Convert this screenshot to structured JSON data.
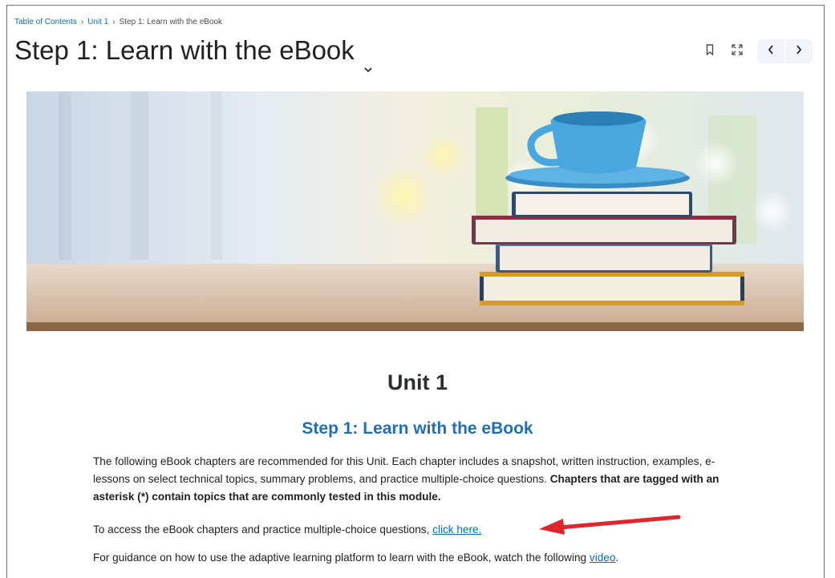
{
  "breadcrumb": {
    "items": [
      "Table of Contents",
      "Unit 1",
      "Step 1: Learn with the eBook"
    ],
    "separator": "›"
  },
  "page": {
    "title": "Step 1: Learn with the eBook"
  },
  "toolbar": {
    "icons": [
      "bookmark-icon",
      "fullscreen-icon",
      "chevron-left-icon",
      "chevron-right-icon"
    ]
  },
  "content": {
    "unit_heading": "Unit 1",
    "step_heading": "Step 1: Learn with the eBook",
    "paragraph1_text": "The following eBook chapters are recommended for this Unit. Each chapter includes a snapshot, written instruction, examples, e-lessons on select technical topics, summary problems, and practice multiple-choice questions. ",
    "paragraph1_bold": "Chapters that are tagged with an asterisk (*) contain topics that are commonly tested in this module.",
    "paragraph2_text": "To access the eBook chapters and practice multiple-choice questions, ",
    "paragraph2_link": "click here.",
    "paragraph3_text": "For guidance on how to use the adaptive learning platform to learn with the eBook, watch the following ",
    "paragraph3_link": "video",
    "paragraph3_end": "."
  },
  "colors": {
    "link": "#006fbf",
    "step_heading": "#1f6fb5",
    "arrow": "#e0262b"
  }
}
